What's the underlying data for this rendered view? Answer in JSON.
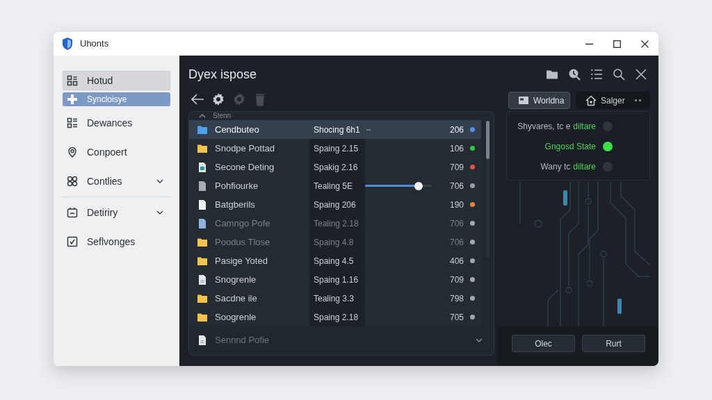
{
  "window": {
    "title": "Uhonts"
  },
  "sidebar": {
    "groups": [
      {
        "items": [
          {
            "label": "Hotud",
            "kind": "link",
            "hovered": true,
            "selected": false
          },
          {
            "label": "Syncloisye",
            "kind": "link",
            "hovered": false,
            "selected": true
          },
          {
            "label": "Dewances",
            "kind": "link",
            "hovered": false,
            "selected": false
          },
          {
            "label": "Conpoert",
            "kind": "link",
            "hovered": false,
            "selected": false
          },
          {
            "label": "Contlies",
            "kind": "group",
            "hovered": false,
            "selected": false
          }
        ]
      },
      {
        "items": [
          {
            "label": "Detiriry",
            "kind": "group",
            "hovered": false,
            "selected": false
          },
          {
            "label": "Seflvonges",
            "kind": "link",
            "hovered": false,
            "selected": false
          }
        ]
      }
    ]
  },
  "main": {
    "title": "Dyex ispose",
    "toolbar": [
      {
        "disabled": false
      },
      {
        "disabled": false
      },
      {
        "disabled": true
      },
      {
        "disabled": true
      }
    ],
    "list": {
      "header": "Stenn",
      "rows": [
        {
          "kind": "folder",
          "name": "Cendbuteo",
          "detail": "Shocing 6h1",
          "size": "206",
          "color": "#5b8fe6",
          "selected": true,
          "dimmed": false,
          "marker": true
        },
        {
          "kind": "folder",
          "name": "Snodpe Pottad",
          "detail": "Spaing 2.15",
          "size": "106",
          "color": "#34c840",
          "selected": false,
          "dimmed": false,
          "marker": false
        },
        {
          "kind": "image",
          "name": "Secone Deting",
          "detail": "Spakig 2.16",
          "size": "709",
          "color": "#e4533f",
          "selected": false,
          "dimmed": false,
          "marker": false
        },
        {
          "kind": "blank",
          "name": "Pohfiourke",
          "detail": "Tealing 5E",
          "level": 0.8,
          "size": "706",
          "color": "#9b9fa5",
          "selected": false,
          "dimmed": false,
          "marker": false
        },
        {
          "kind": "file",
          "name": "Batgberils",
          "detail": "Spaing 206",
          "size": "190",
          "color": "#d98b35",
          "selected": false,
          "dimmed": false,
          "marker": false
        },
        {
          "kind": "note",
          "name": "Camngo Pofe",
          "detail": "Tealing 2.18",
          "size": "706",
          "color": "#a3a7ad",
          "selected": false,
          "dimmed": true,
          "marker": false
        },
        {
          "kind": "folder",
          "name": "Poodus Tlose",
          "detail": "Spaing 4.8",
          "size": "706",
          "color": "#a3a7ad",
          "selected": false,
          "dimmed": true,
          "marker": false
        },
        {
          "kind": "folder",
          "name": "Pasige Yoted",
          "detail": "Spaing 4.5",
          "size": "406",
          "color": "#a3a7ad",
          "selected": false,
          "dimmed": false,
          "marker": false
        },
        {
          "kind": "doc",
          "name": "Snogrenle",
          "detail": "Spaing 1.16",
          "size": "709",
          "color": "#a3a7ad",
          "selected": false,
          "dimmed": false,
          "marker": false
        },
        {
          "kind": "folder",
          "name": "Sacdne ile",
          "detail": "Tealing 3.3",
          "size": "798",
          "color": "#a3a7ad",
          "selected": false,
          "dimmed": false,
          "marker": false
        },
        {
          "kind": "folder",
          "name": "Soogrenle",
          "detail": "Spaing 2.18",
          "size": "705",
          "color": "#a3a7ad",
          "selected": false,
          "dimmed": false,
          "marker": false
        }
      ],
      "more": {
        "kind": "doc",
        "name": "Sennnd Pofie"
      }
    }
  },
  "panel": {
    "tabs": [
      {
        "label": "Worldna",
        "selected": true
      },
      {
        "label": "Salger",
        "selected": false
      }
    ],
    "status": [
      {
        "text": "Shyvares, tc e",
        "highlight": "diltare",
        "on": false
      },
      {
        "text": "Gngosd State",
        "on": true
      },
      {
        "text": "Wany tc",
        "highlight": "diltare",
        "on": false
      }
    ],
    "buttons": [
      "Olec",
      "Rurt"
    ]
  }
}
